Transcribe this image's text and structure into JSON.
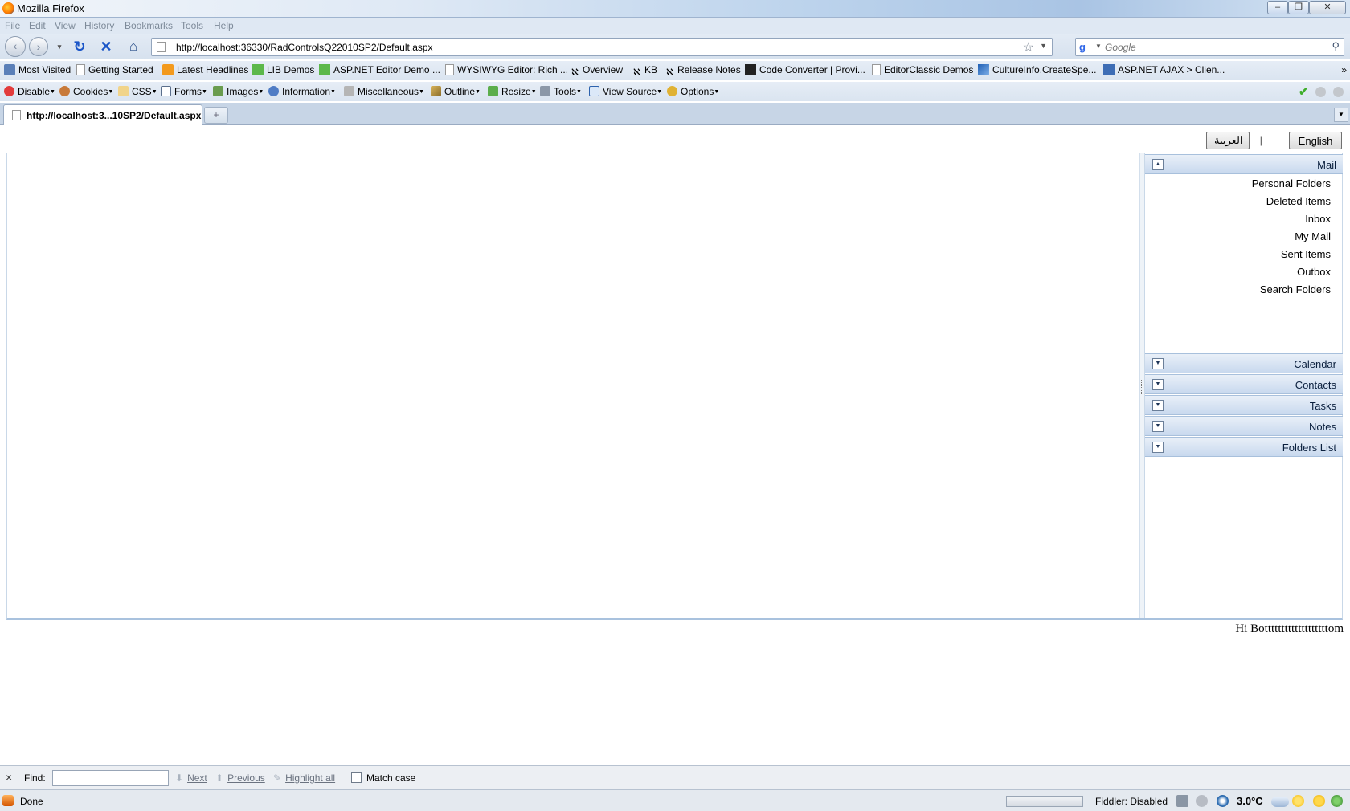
{
  "window": {
    "title": "Mozilla Firefox"
  },
  "menu": {
    "items": [
      "File",
      "Edit",
      "View",
      "History",
      "Bookmarks",
      "Tools",
      "Help"
    ]
  },
  "nav": {
    "url": "http://localhost:36330/RadControlsQ22010SP2/Default.aspx",
    "search_placeholder": "Google"
  },
  "bookmarks": {
    "items": [
      "Most Visited",
      "Getting Started",
      "Latest Headlines",
      "LIB Demos",
      "ASP.NET Editor Demo ...",
      "WYSIWYG Editor: Rich ...",
      "Overview",
      "KB",
      "Release Notes",
      "Code Converter | Provi...",
      "EditorClassic Demos",
      "CultureInfo.CreateSpe...",
      "ASP.NET AJAX > Clien..."
    ],
    "more": "»"
  },
  "devtoolbar": {
    "items": [
      "Disable",
      "Cookies",
      "CSS",
      "Forms",
      "Images",
      "Information",
      "Miscellaneous",
      "Outline",
      "Resize",
      "Tools",
      "View Source",
      "Options"
    ]
  },
  "tabs": {
    "active_label": "http://localhost:3...10SP2/Default.aspx",
    "new_tab": "+"
  },
  "page": {
    "lang_arabic": "العربية",
    "lang_separator": "|",
    "lang_english": "English",
    "greeting": "Hi Botttttttttttttttttttom",
    "panelbar": {
      "mail_header": "Mail",
      "mail_items": [
        "Personal Folders",
        "Deleted Items",
        "Inbox",
        "My Mail",
        "Sent Items",
        "Outbox",
        "Search Folders"
      ],
      "collapsed_headers": [
        "Calendar",
        "Contacts",
        "Tasks",
        "Notes",
        "Folders List"
      ]
    }
  },
  "findbar": {
    "close": "×",
    "label": "Find:",
    "next": "Next",
    "previous": "Previous",
    "highlight": "Highlight all",
    "match_case": "Match case"
  },
  "status": {
    "text": "Done",
    "fiddler": "Fiddler: Disabled",
    "temperature": "3.0°C"
  },
  "colors": {
    "panel_header": "#c8d9ee",
    "panel_border": "#a8c0dc",
    "stop_icon": "#1b56c8",
    "reload_icon": "#1b56c8",
    "green_check": "#3fae2a"
  }
}
